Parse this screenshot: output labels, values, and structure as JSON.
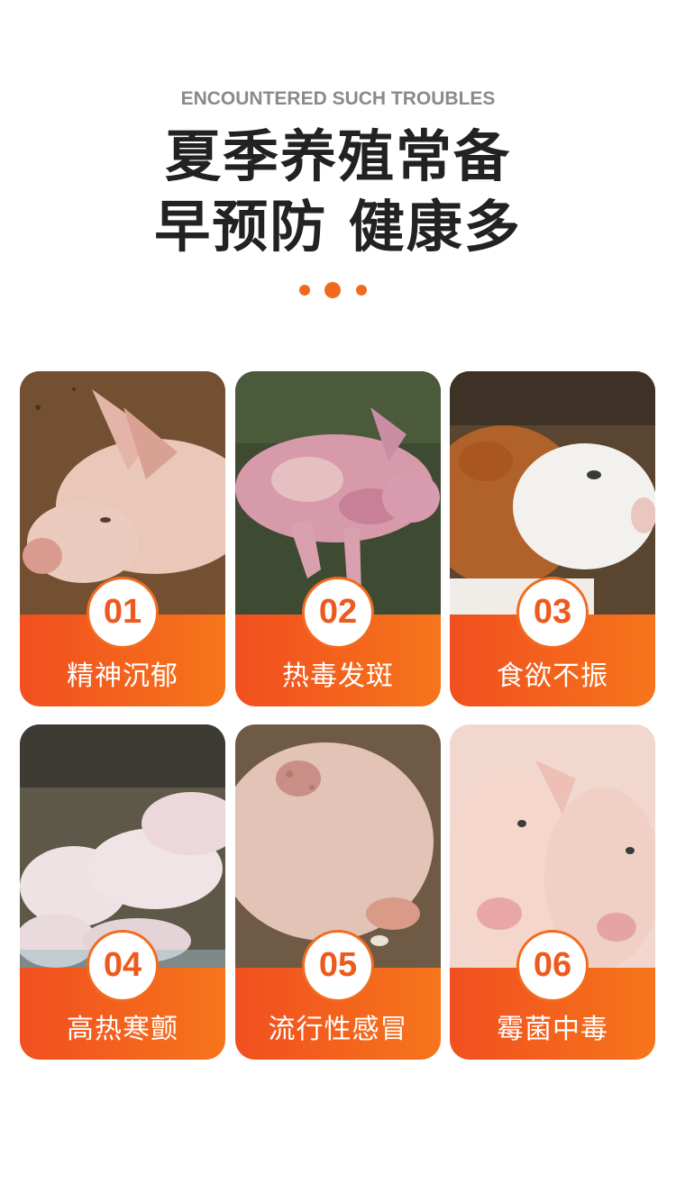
{
  "header": {
    "subtitle": "ENCOUNTERED SUCH TROUBLES",
    "title_line1": "夏季养殖常备",
    "title_line2": "早预防 健康多"
  },
  "colors": {
    "accent": "#f06a1e",
    "band_start": "#f14f1f",
    "band_end": "#f6751b",
    "title": "#222222",
    "subtitle": "#8a8a8a"
  },
  "cards": [
    {
      "number": "01",
      "label": "精神沉郁",
      "image": "lying-pig-photo"
    },
    {
      "number": "02",
      "label": "热毒发斑",
      "image": "spotted-pig-photo"
    },
    {
      "number": "03",
      "label": "食欲不振",
      "image": "calf-photo"
    },
    {
      "number": "04",
      "label": "高热寒颤",
      "image": "piglets-photo"
    },
    {
      "number": "05",
      "label": "流行性感冒",
      "image": "sick-pig-photo"
    },
    {
      "number": "06",
      "label": "霉菌中毒",
      "image": "two-pigs-photo"
    }
  ]
}
